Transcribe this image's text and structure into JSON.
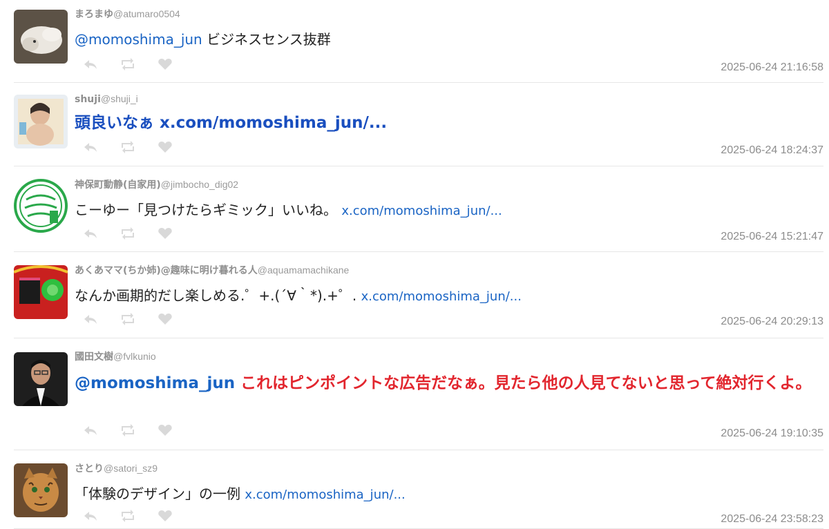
{
  "tweets": [
    {
      "name": "まろまゆ",
      "handle": "@atumaro0504",
      "mention": "@momoshima_jun",
      "body": " ビジネスセンス抜群",
      "link": "",
      "time": "2025-06-24 21:16:58",
      "avatar_icon": "cat-photo-avatar",
      "style": "normal"
    },
    {
      "name": "shuji",
      "handle": "@shuji_i",
      "mention": "",
      "body": "頭良いなぁ ",
      "link": "x.com/momoshima_jun/...",
      "time": "2025-06-24 18:24:37",
      "avatar_icon": "painting-avatar",
      "style": "big-blue"
    },
    {
      "name": "神保町動静(自家用)",
      "handle": "@jimbocho_dig02",
      "mention": "",
      "body": "こーゆー「見つけたらギミック」いいね。 ",
      "link": "x.com/momoshima_jun/...",
      "time": "2025-06-24 15:21:47",
      "avatar_icon": "green-stamp-avatar",
      "style": "normal"
    },
    {
      "name": "あくあママ(ちか姉)@趣味に明け暮れる人",
      "handle": "@aquamamachikane",
      "mention": "",
      "body": "なんか画期的だし楽しめる.゜+.(´∀｀*).+゜. ",
      "link": "x.com/momoshima_jun/...",
      "time": "2025-06-24 20:29:13",
      "avatar_icon": "craft-items-avatar",
      "style": "normal"
    },
    {
      "name": "國田文樹",
      "handle": "@fvlkunio",
      "mention": "@momoshima_jun",
      "body": " これはピンポイントな広告だなぁ。見たら他の人見てないと思って絶対行くよ。",
      "link": "",
      "time": "2025-06-24 19:10:35",
      "avatar_icon": "man-portrait-avatar",
      "style": "big-red"
    },
    {
      "name": "さとり",
      "handle": "@satori_sz9",
      "mention": "",
      "body": "「体験のデザイン」の一例 ",
      "link": "x.com/momoshima_jun/...",
      "time": "2025-06-24 23:58:23",
      "avatar_icon": "bengal-cat-avatar",
      "style": "normal"
    }
  ],
  "actions": {
    "reply_icon": "reply-icon",
    "retweet_icon": "retweet-icon",
    "like_icon": "heart-icon"
  },
  "colors": {
    "link": "#1a64c4",
    "emphasis_blue": "#1a4fbf",
    "emphasis_red": "#e2262e",
    "meta_gray": "#8f8f8f",
    "action_gray": "#d9d9d9"
  }
}
